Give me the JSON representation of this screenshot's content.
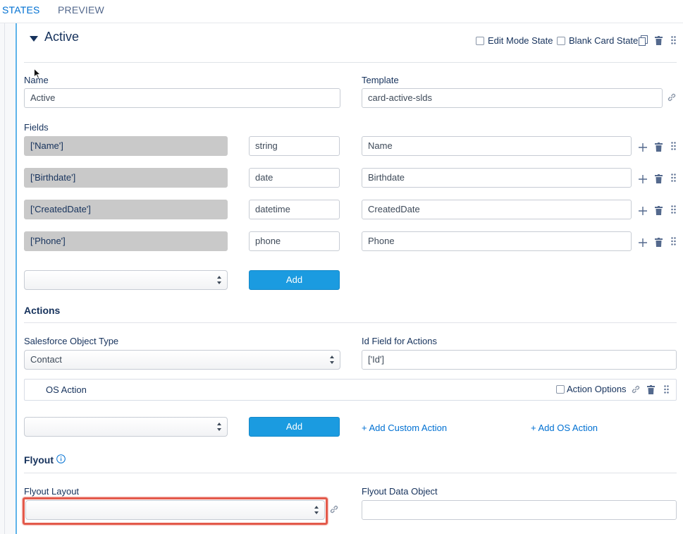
{
  "tabs": [
    {
      "label": "STATES",
      "active": true
    },
    {
      "label": "PREVIEW",
      "active": false
    }
  ],
  "state": {
    "title": "Active",
    "edit_mode_label": "Edit Mode State",
    "blank_card_label": "Blank Card State"
  },
  "name": {
    "label": "Name",
    "value": "Active"
  },
  "template": {
    "label": "Template",
    "value": "card-active-slds"
  },
  "fields": {
    "label": "Fields",
    "rows": [
      {
        "key": "['Name']",
        "type": "string",
        "label": "Name"
      },
      {
        "key": "['Birthdate']",
        "type": "date",
        "label": "Birthdate"
      },
      {
        "key": "['CreatedDate']",
        "type": "datetime",
        "label": "CreatedDate"
      },
      {
        "key": "['Phone']",
        "type": "phone",
        "label": "Phone"
      }
    ],
    "add_select_value": "",
    "add_label": "Add"
  },
  "actions": {
    "heading": "Actions",
    "object_type_label": "Salesforce Object Type",
    "object_type_value": "Contact",
    "id_field_label": "Id Field for Actions",
    "id_field_value": "['Id']",
    "os_action_label": "OS Action",
    "action_options_label": "Action Options",
    "add_select_value": "",
    "add_label": "Add",
    "add_custom_action": "+ Add Custom Action",
    "add_os_action": "+ Add OS Action"
  },
  "flyout": {
    "heading": "Flyout",
    "layout_label": "Flyout Layout",
    "layout_value": "",
    "data_object_label": "Flyout Data Object",
    "data_object_value": ""
  },
  "colors": {
    "accent": "#0070d2",
    "button": "#1b9be0",
    "highlight": "#e35a4b",
    "field_key_bg": "#c9c9c9",
    "left_rule": "#5eb4ea"
  },
  "icons": [
    "caret-down-icon",
    "copy-icon",
    "trash-icon",
    "drag-handle-icon",
    "link-icon",
    "plus-icon",
    "info-icon",
    "mouse-cursor-icon"
  ]
}
